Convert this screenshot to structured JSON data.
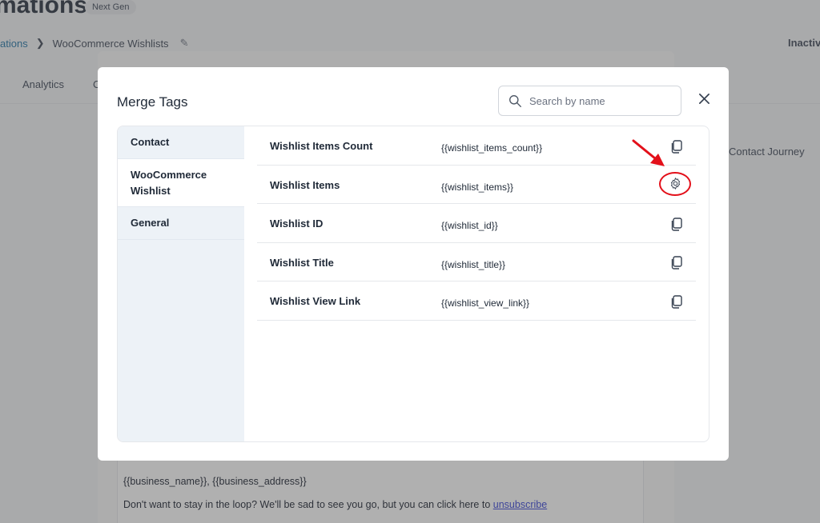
{
  "background": {
    "title": "mations",
    "badge": "Next Gen",
    "breadcrumb": {
      "parent": "ations",
      "current": "WooCommerce Wishlists"
    },
    "status": "Inactiv",
    "tabs": [
      {
        "label": "Analytics"
      },
      {
        "label": "C"
      }
    ],
    "side_text": "Contact Journey",
    "footer_tags": "{{business_name}}, {{business_address}}",
    "footer_text": "Don't want to stay in the loop? We'll be sad to see you go, but you can click here to ",
    "footer_link": "unsubscribe"
  },
  "modal": {
    "title": "Merge Tags",
    "search": {
      "placeholder": "Search by name",
      "value": ""
    },
    "categories": [
      {
        "label": "Contact",
        "active": false
      },
      {
        "label": "WooCommerce Wishlist",
        "active": true
      },
      {
        "label": "General",
        "active": false
      }
    ],
    "tags": [
      {
        "name": "Wishlist Items Count",
        "tag": "{{wishlist_items_count}}",
        "action": "copy-icon"
      },
      {
        "name": "Wishlist Items",
        "tag": "{{wishlist_items}}",
        "action": "gear-icon"
      },
      {
        "name": "Wishlist ID",
        "tag": "{{wishlist_id}}",
        "action": "copy-icon"
      },
      {
        "name": "Wishlist Title",
        "tag": "{{wishlist_title}}",
        "action": "copy-icon"
      },
      {
        "name": "Wishlist View Link",
        "tag": "{{wishlist_view_link}}",
        "action": "copy-icon"
      }
    ]
  },
  "colors": {
    "highlight": "#e3101a",
    "sidebar": "#edf2f7",
    "link": "#1a6fa3"
  }
}
